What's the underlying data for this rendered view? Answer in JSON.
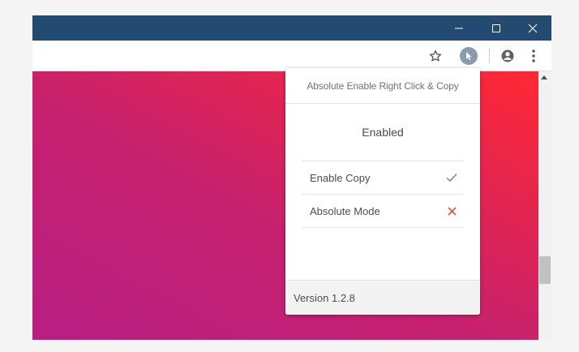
{
  "window": {
    "controls": {
      "minimize_icon": "minimize-icon",
      "maximize_icon": "maximize-icon",
      "close_icon": "close-icon"
    }
  },
  "toolbar": {
    "icons": [
      "star-icon",
      "extension-icon",
      "profile-icon",
      "menu-icon"
    ]
  },
  "popup": {
    "title": "Absolute Enable Right Click & Copy",
    "status": "Enabled",
    "options": [
      {
        "label": "Enable Copy",
        "state": "on",
        "icon": "check-icon",
        "color": "#5fae5b"
      },
      {
        "label": "Absolute Mode",
        "state": "off",
        "icon": "x-icon",
        "color": "#d9534f"
      }
    ],
    "version": "Version 1.2.8"
  },
  "colors": {
    "titlebar": "#234a71",
    "gradient_start": "#b81e83",
    "gradient_end": "#ff2833"
  }
}
